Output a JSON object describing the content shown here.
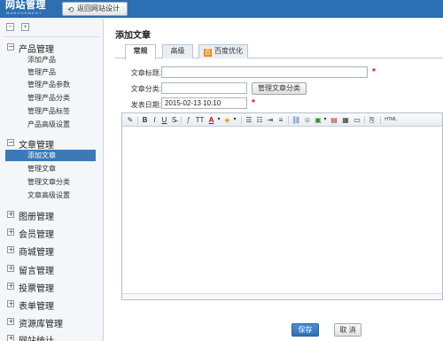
{
  "header": {
    "logo": "网站管理",
    "logo_sub": "MANAGEMENT",
    "back_button": "返回网站设计",
    "brand_color": "#2c6fb3"
  },
  "sidebar": {
    "toolbar": {
      "collapse_icon": "collapse-all-icon",
      "expand_icon": "expand-all-icon"
    },
    "groups": [
      {
        "title": "产品管理",
        "expanded": true,
        "items": [
          "添加产品",
          "管理产品",
          "管理产品参数",
          "管理产品分类",
          "管理产品标签",
          "产品高级设置"
        ]
      },
      {
        "title": "文章管理",
        "expanded": true,
        "items": [
          "添加文章",
          "管理文章",
          "管理文章分类",
          "文章高级设置"
        ],
        "active_item": "添加文章"
      },
      {
        "title": "图册管理",
        "expanded": false
      },
      {
        "title": "会员管理",
        "expanded": false
      },
      {
        "title": "商城管理",
        "expanded": false
      },
      {
        "title": "留言管理",
        "expanded": false
      },
      {
        "title": "投票管理",
        "expanded": false
      },
      {
        "title": "表单管理",
        "expanded": false
      },
      {
        "title": "资源库管理",
        "expanded": false
      },
      {
        "title": "网站统计",
        "expanded": false
      }
    ]
  },
  "main": {
    "title": "添加文章",
    "tabs": [
      {
        "label": "常规",
        "active": true
      },
      {
        "label": "高级",
        "active": false
      },
      {
        "label": "百度优化",
        "active": false,
        "badge": "百"
      }
    ],
    "form": {
      "title_label": "文章标题:",
      "title_value": "",
      "category_label": "文章分类:",
      "category_value": "",
      "category_button": "管理文章分类",
      "date_label": "发表日期:",
      "date_value": "2015-02-13 10:10",
      "required_mark": "*"
    },
    "editor_toolbar": {
      "bold": "B",
      "italic": "I",
      "underline": "U",
      "font_size": "TT",
      "font_color": "A",
      "html": "HTML"
    },
    "save_button": "保存",
    "cancel_button": "取 消"
  }
}
